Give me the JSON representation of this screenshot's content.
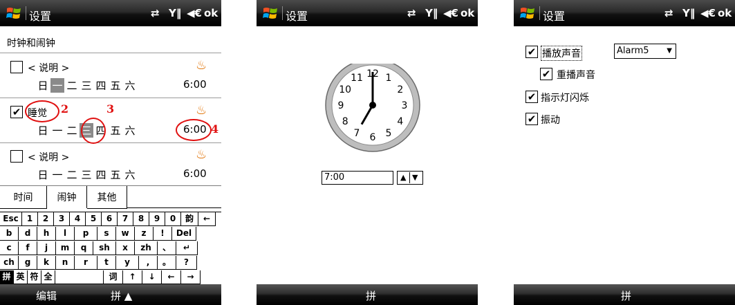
{
  "screen1": {
    "title": "设置",
    "status": "⇄ Y‖ ◀€ ok",
    "ok": "ok",
    "subtitle": "时钟和闹钟",
    "alarms": [
      {
        "name": "< 说明 >",
        "checked": false,
        "days": [
          "日",
          "一",
          "二",
          "三",
          "四",
          "五",
          "六"
        ],
        "selected_day": 1,
        "time": "6:00"
      },
      {
        "name": "睡觉",
        "checked": true,
        "days": [
          "日",
          "一",
          "二",
          "三",
          "四",
          "五",
          "六"
        ],
        "selected_day": 3,
        "time": "6:00"
      },
      {
        "name": "< 说明 >",
        "checked": false,
        "days": [
          "日",
          "一",
          "二",
          "三",
          "四",
          "五",
          "六"
        ],
        "selected_day": -1,
        "time": "6:00"
      }
    ],
    "annotations": [
      "2",
      "3",
      "4"
    ],
    "tabs": [
      "时间",
      "闹钟",
      "其他"
    ],
    "keyboard": {
      "row1": [
        "Esc",
        "1",
        "2",
        "3",
        "4",
        "5",
        "6",
        "7",
        "8",
        "9",
        "0",
        "韵",
        "←"
      ],
      "row2": [
        "b",
        "d",
        "h",
        "l",
        "p",
        "s",
        "w",
        "z",
        "!",
        "Del"
      ],
      "row3": [
        "c",
        "f",
        "j",
        "m",
        "q",
        "sh",
        "x",
        "zh",
        "、",
        "↵"
      ],
      "row4": [
        "ch",
        "g",
        "k",
        "n",
        "r",
        "t",
        "y",
        ",",
        "。",
        "?"
      ],
      "row5": [
        "拼",
        "英",
        "符",
        "全",
        "",
        "词",
        "↑",
        "↓",
        "←",
        "→"
      ]
    },
    "softkey_left": "编辑",
    "softkey_mid": "拼 ▲"
  },
  "screen2": {
    "title": "设置",
    "clock": {
      "numbers": [
        "12",
        "1",
        "2",
        "3",
        "4",
        "5",
        "6",
        "7",
        "8",
        "9",
        "10",
        "11"
      ],
      "hour": 7,
      "minute": 0
    },
    "time_field": "7:00",
    "softkey_mid": "拼"
  },
  "screen3": {
    "title": "设置",
    "play_sound": "播放声音",
    "sound_value": "Alarm5",
    "repeat_sound": "重播声音",
    "indicator_light": "指示灯闪烁",
    "vibrate": "振动",
    "softkey_mid": "拼"
  },
  "colors": {
    "annotation": "#e01010",
    "bell": "#e07000"
  }
}
